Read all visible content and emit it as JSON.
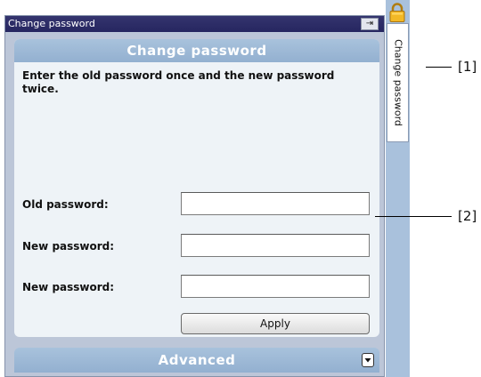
{
  "window": {
    "title": "Change password",
    "pin_label": "⇥"
  },
  "section": {
    "header": "Change password",
    "instruction": "Enter the old password once and the new password twice."
  },
  "fields": [
    {
      "label": "Old password:",
      "value": "",
      "placeholder": ""
    },
    {
      "label": "New password:",
      "value": "",
      "placeholder": ""
    },
    {
      "label": "New password:",
      "value": "",
      "placeholder": ""
    }
  ],
  "buttons": {
    "apply": "Apply"
  },
  "advanced": {
    "label": "Advanced"
  },
  "side_tab": {
    "label": "Change password",
    "icon": "lock-icon"
  },
  "callouts": {
    "c1": "[1]",
    "c2": "[2]"
  },
  "colors": {
    "titlebar": "#2c2c66",
    "section_header": "#9fb9d6",
    "tab_strip": "#a9c1dc",
    "content_bg": "#eef3f7"
  }
}
